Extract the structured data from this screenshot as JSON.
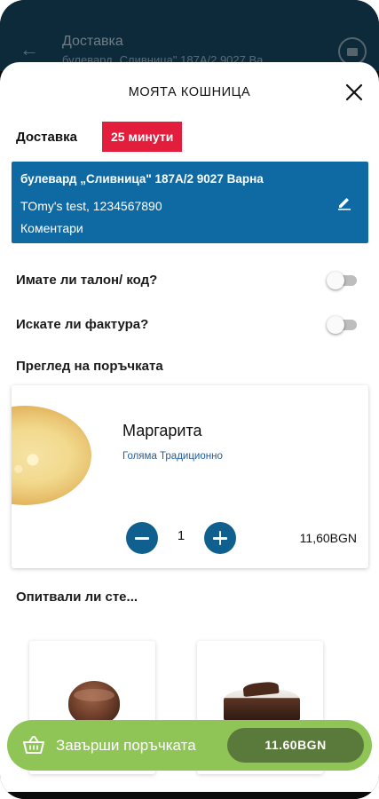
{
  "background": {
    "title": "Доставка",
    "subtitle": "булевард „Сливница\" 187А/2 9027 Ва..."
  },
  "sheet": {
    "title": "МОЯТА КОШНИЦА"
  },
  "delivery": {
    "label": "Доставка",
    "time": "25 минути"
  },
  "address": {
    "line": "булевард „Сливница\" 187А/2 9027 Варна",
    "user": "TOmy's test, 1234567890",
    "comment": "Коментари"
  },
  "options": {
    "voucher_label": "Имате ли талон/ код?",
    "voucher_enabled": false,
    "invoice_label": "Искате ли фактура?",
    "invoice_enabled": false
  },
  "order": {
    "section_title": "Преглед на поръчката",
    "items": [
      {
        "name": "Маргарита",
        "description": "Голяма Традиционно",
        "quantity": "1",
        "price": "11,60BGN"
      }
    ]
  },
  "suggestions": {
    "title": "Опитвали ли сте..."
  },
  "checkout": {
    "label": "Завърши поръчката",
    "total": "11.60BGN"
  },
  "colors": {
    "accent_blue": "#0f6aa3",
    "badge_red": "#e31e3d",
    "checkout_green": "#8fc457",
    "total_pill_green": "#5a7a3b"
  },
  "icons": [
    "back-arrow-icon",
    "card-icon",
    "close-icon",
    "edit-icon",
    "minus-icon",
    "plus-icon",
    "basket-icon"
  ]
}
